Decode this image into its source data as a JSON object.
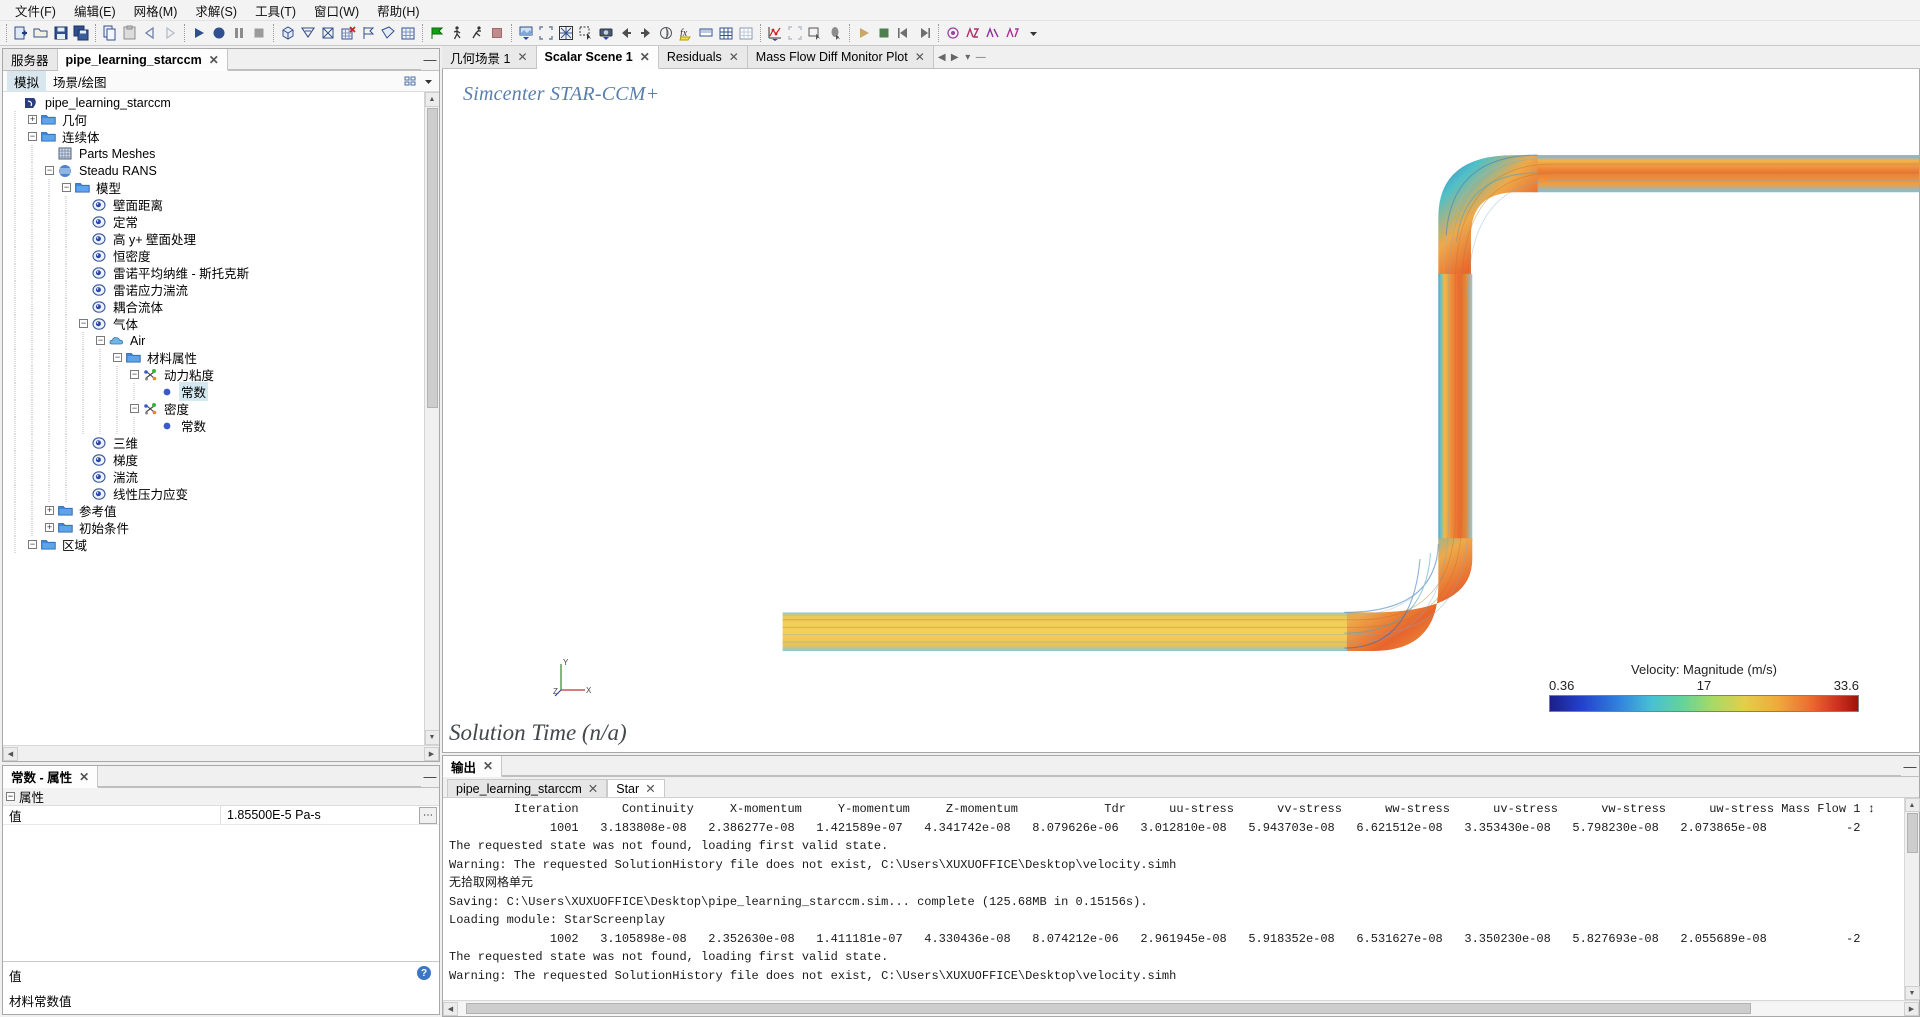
{
  "menubar": [
    {
      "label": "文件(F)",
      "name": "menu-file"
    },
    {
      "label": "编辑(E)",
      "name": "menu-edit"
    },
    {
      "label": "网格(M)",
      "name": "menu-mesh"
    },
    {
      "label": "求解(S)",
      "name": "menu-solve"
    },
    {
      "label": "工具(T)",
      "name": "menu-tools"
    },
    {
      "label": "窗口(W)",
      "name": "menu-window"
    },
    {
      "label": "帮助(H)",
      "name": "menu-help"
    }
  ],
  "toolbar_groups": [
    [
      "new-simulation-icon",
      "open-simulation-icon",
      "save-icon",
      "save-all-icon"
    ],
    [
      "copy-icon",
      "paste-icon",
      "undo-icon",
      "redo-icon"
    ],
    [
      "run-icon",
      "step-icon",
      "pause-icon",
      "stop-icon"
    ],
    [
      "generate-volume-mesh-icon",
      "generate-surface-mesh-icon",
      "clear-mesh-icon",
      "mesh-grid-delete-icon",
      "flag-outline-icon",
      "surface-repair-icon",
      "mesh-table-icon"
    ],
    [
      "initialize-solution-icon",
      "run-step-walk-icon",
      "run-run-icon",
      "stop-solid-icon"
    ],
    [
      "new-scene-icon",
      "fit-view-icon",
      "restore-view-icon",
      "rubber-band-select-icon",
      "save-image-icon",
      "previous-view-icon",
      "next-view-icon",
      "clip-plane-icon",
      "field-function-icon",
      "colorbar-icon",
      "grid-icon",
      "table-grid-icon"
    ],
    [
      "new-plot-icon",
      "plot-fit-icon",
      "plot-select-icon",
      "plot-probe-icon"
    ],
    [
      "play-anim-icon",
      "stop-anim-icon",
      "prev-frame-icon",
      "next-frame-icon"
    ],
    [
      "record-anim-icon",
      "note-red-icon",
      "note-blue-icon",
      "note-green-icon",
      "dropdown-arrow-icon"
    ]
  ],
  "explorer": {
    "tabs": [
      {
        "label": "服务器",
        "name": "tab-server",
        "active": false,
        "closable": false
      },
      {
        "label": "pipe_learning_starccm",
        "name": "tab-simulation",
        "active": true,
        "closable": true
      }
    ],
    "subtabs": [
      {
        "label": "模拟",
        "name": "subtab-simulation",
        "selected": true
      },
      {
        "label": "场景/绘图",
        "name": "subtab-scenes-plots",
        "selected": false
      }
    ],
    "tree": [
      {
        "depth": 0,
        "label": "pipe_learning_starccm",
        "icon": "simulation-icon",
        "expander": "none",
        "selected": false
      },
      {
        "depth": 1,
        "label": "几何",
        "icon": "folder-icon",
        "expander": "+",
        "selected": false
      },
      {
        "depth": 1,
        "label": "连续体",
        "icon": "folder-icon",
        "expander": "-",
        "selected": false
      },
      {
        "depth": 2,
        "label": "Parts Meshes",
        "icon": "mesh-icon",
        "expander": "none",
        "selected": false
      },
      {
        "depth": 2,
        "label": "Steadu RANS",
        "icon": "continuum-icon",
        "expander": "-",
        "selected": false
      },
      {
        "depth": 3,
        "label": "模型",
        "icon": "folder-icon",
        "expander": "-",
        "selected": false
      },
      {
        "depth": 4,
        "label": "壁面距离",
        "icon": "model-icon",
        "expander": "none",
        "selected": false
      },
      {
        "depth": 4,
        "label": "定常",
        "icon": "model-icon",
        "expander": "none",
        "selected": false
      },
      {
        "depth": 4,
        "label": "高 y+ 壁面处理",
        "icon": "model-icon",
        "expander": "none",
        "selected": false
      },
      {
        "depth": 4,
        "label": "恒密度",
        "icon": "model-icon",
        "expander": "none",
        "selected": false
      },
      {
        "depth": 4,
        "label": "雷诺平均纳维 - 斯托克斯",
        "icon": "model-icon",
        "expander": "none",
        "selected": false
      },
      {
        "depth": 4,
        "label": "雷诺应力湍流",
        "icon": "model-icon",
        "expander": "none",
        "selected": false
      },
      {
        "depth": 4,
        "label": "耦合流体",
        "icon": "model-icon",
        "expander": "none",
        "selected": false
      },
      {
        "depth": 4,
        "label": "气体",
        "icon": "model-icon",
        "expander": "-",
        "selected": false
      },
      {
        "depth": 5,
        "label": "Air",
        "icon": "gas-cloud-icon",
        "expander": "-",
        "selected": false
      },
      {
        "depth": 6,
        "label": "材料属性",
        "icon": "folder-icon",
        "expander": "-",
        "selected": false
      },
      {
        "depth": 7,
        "label": "动力粘度",
        "icon": "property-icon",
        "expander": "-",
        "selected": false
      },
      {
        "depth": 8,
        "label": "常数",
        "icon": "dot-icon",
        "expander": "none",
        "selected": true
      },
      {
        "depth": 7,
        "label": "密度",
        "icon": "property-icon",
        "expander": "-",
        "selected": false
      },
      {
        "depth": 8,
        "label": "常数",
        "icon": "dot-icon",
        "expander": "none",
        "selected": false
      },
      {
        "depth": 4,
        "label": "三维",
        "icon": "model-icon",
        "expander": "none",
        "selected": false
      },
      {
        "depth": 4,
        "label": "梯度",
        "icon": "model-icon",
        "expander": "none",
        "selected": false
      },
      {
        "depth": 4,
        "label": "湍流",
        "icon": "model-icon",
        "expander": "none",
        "selected": false
      },
      {
        "depth": 4,
        "label": "线性压力应变",
        "icon": "model-icon",
        "expander": "none",
        "selected": false
      },
      {
        "depth": 2,
        "label": "参考值",
        "icon": "folder-icon",
        "expander": "+",
        "selected": false
      },
      {
        "depth": 2,
        "label": "初始条件",
        "icon": "folder-icon",
        "expander": "+",
        "selected": false
      },
      {
        "depth": 1,
        "label": "区域",
        "icon": "folder-icon",
        "expander": "-",
        "selected": false
      }
    ]
  },
  "properties": {
    "tab_label": "常数 - 属性",
    "group_label": "属性",
    "rows": [
      {
        "name": "值",
        "value": "1.85500E-5 Pa-s"
      }
    ],
    "footer_title": "值",
    "footer_desc": "材料常数值",
    "help_icon": "?"
  },
  "scene": {
    "tabs": [
      {
        "label": "几何场景 1",
        "name": "tab-geometry-scene-1",
        "active": false
      },
      {
        "label": "Scalar Scene 1",
        "name": "tab-scalar-scene-1",
        "active": true
      },
      {
        "label": "Residuals",
        "name": "tab-residuals",
        "active": false
      },
      {
        "label": "Mass Flow Diff Monitor Plot",
        "name": "tab-mass-flow-diff-monitor-plot",
        "active": false
      }
    ],
    "watermark": "Simcenter STAR-CCM+",
    "solution_time": "Solution Time (n/a)",
    "axes": {
      "x": "X",
      "y": "Y",
      "z": "Z"
    },
    "legend": {
      "title": "Velocity: Magnitude (m/s)",
      "min": "0.36",
      "mid": "17",
      "max": "33.6"
    }
  },
  "output": {
    "tab_label": "输出",
    "subtabs": [
      {
        "label": "pipe_learning_starccm",
        "name": "out-tab-simulation",
        "active": false
      },
      {
        "label": "Star",
        "name": "out-tab-star",
        "active": true
      }
    ],
    "columns": [
      "Iteration",
      "Continuity",
      "X-momentum",
      "Y-momentum",
      "Z-momentum",
      "Tdr",
      "uu-stress",
      "vv-stress",
      "ww-stress",
      "uv-stress",
      "vw-stress",
      "uw-stress",
      "Mass Flow 1 ↕"
    ],
    "lines": [
      "         Iteration      Continuity     X-momentum     Y-momentum     Z-momentum            Tdr      uu-stress      vv-stress      ww-stress      uv-stress      vw-stress      uw-stress Mass Flow 1 ↕",
      "              1001   3.183808e-08   2.386277e-08   1.421589e-07   4.341742e-08   8.079626e-06   3.012810e-08   5.943703e-08   6.621512e-08   3.353430e-08   5.798230e-08   2.073865e-08           -2",
      "The requested state was not found, loading first valid state.",
      "Warning: The requested SolutionHistory file does not exist, C:\\Users\\XUXUOFFICE\\Desktop\\velocity.simh",
      "无拾取网格单元",
      "Saving: C:\\Users\\XUXUOFFICE\\Desktop\\pipe_learning_starccm.sim... complete (125.68MB in 0.15156s).",
      "Loading module: StarScreenplay",
      "              1002   3.105898e-08   2.352630e-08   1.411181e-07   4.330436e-08   8.074212e-06   2.961945e-08   5.918352e-08   6.531627e-08   3.350230e-08   5.827693e-08   2.055689e-08           -2",
      "The requested state was not found, loading first valid state.",
      "Warning: The requested SolutionHistory file does not exist, C:\\Users\\XUXUOFFICE\\Desktop\\velocity.simh"
    ]
  },
  "colors": {
    "accent": "#3d76c4",
    "scene_watermark": "#5a7fae",
    "tree_selection": "#d4e8ef",
    "panel_bg": "#f0f0f0"
  }
}
